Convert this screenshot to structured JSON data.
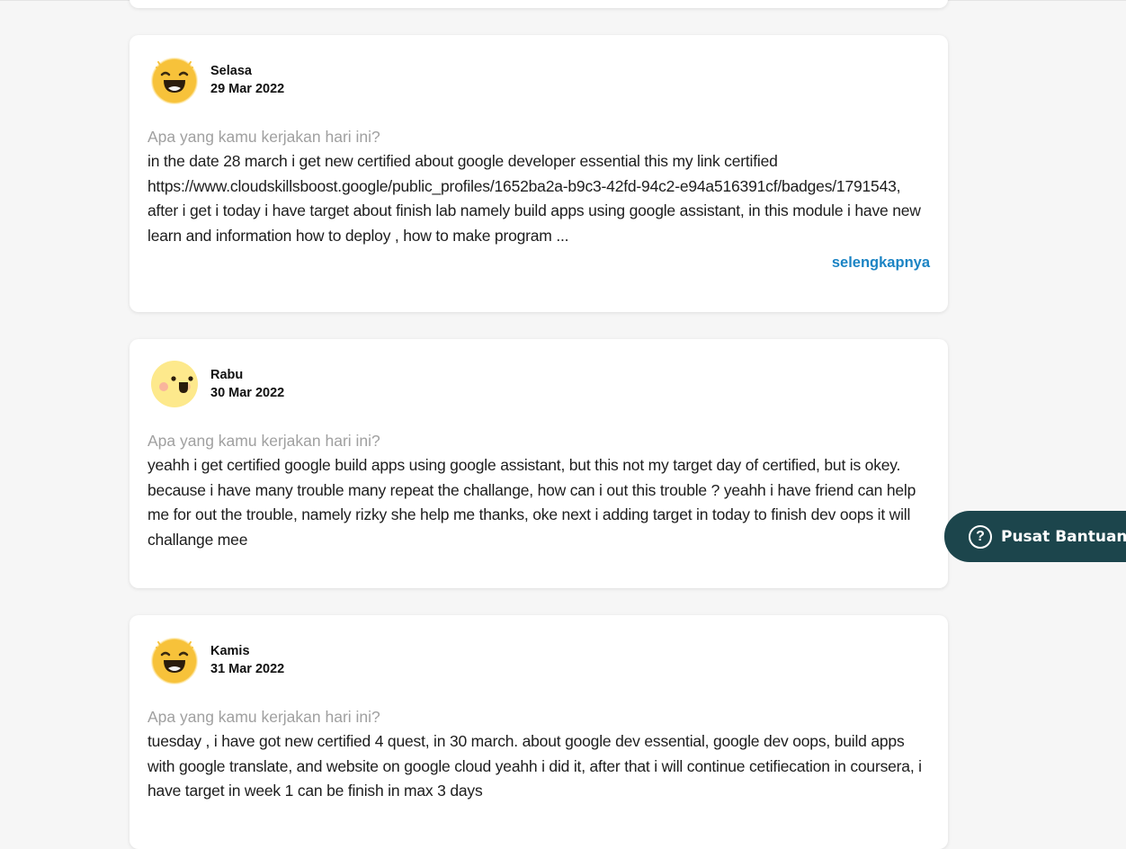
{
  "entries": [
    {
      "day": "Selasa",
      "date": "29 Mar 2022",
      "mood": "laughing-emoji",
      "question": "Apa yang kamu kerjakan hari ini?",
      "answer": "in the date 28 march i get new certified about google developer essential this my link certified https://www.cloudskillsboost.google/public_profiles/1652ba2a-b9c3-42fd-94c2-e94a516391cf/badges/1791543, after i get i today i have target about finish lab namely build apps using google assistant, in this module i have new learn and information how to deploy , how to make program ...",
      "more_label": "selengkapnya"
    },
    {
      "day": "Rabu",
      "date": "30 Mar 2022",
      "mood": "happy-emoji",
      "question": "Apa yang kamu kerjakan hari ini?",
      "answer": "yeahh i get certified google build apps using google assistant, but this not my target day of certified, but is okey. because i have many trouble many repeat the challange, how can i out this trouble ? yeahh i have friend can help me for out the trouble, namely rizky she help me thanks, oke next i adding target in today to finish dev oops it will challange mee"
    },
    {
      "day": "Kamis",
      "date": "31 Mar 2022",
      "mood": "laughing-emoji",
      "question": "Apa yang kamu kerjakan hari ini?",
      "answer": "tuesday , i have got new certified 4 quest, in 30 march. about google dev essential, google dev oops, build apps with google translate, and website on google cloud yeahh i did it, after that i will continue cetifiecation in coursera, i have target in week 1 can be finish in max 3 days"
    }
  ],
  "help_button": {
    "icon": "question-circle-icon",
    "label": "Pusat Bantuan"
  },
  "colors": {
    "background": "#f6f6f6",
    "card": "#ffffff",
    "link": "#1b84c4",
    "help_button": "#1c454c",
    "question_text": "#a0a0a0"
  }
}
